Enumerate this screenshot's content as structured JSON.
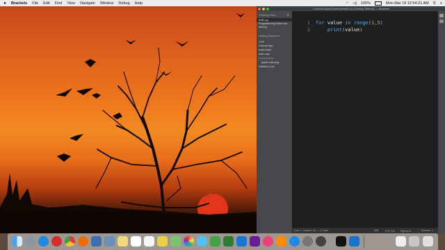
{
  "menubar": {
    "app_name": "Brackets",
    "items": [
      "File",
      "Edit",
      "Find",
      "View",
      "Navigate",
      "Window",
      "Debug",
      "Help"
    ],
    "battery": "100%",
    "clock": "Mon Mar 19  12:54:21 AM"
  },
  "window": {
    "title": "• /Users/Casper/Desktop/hello.py (Getting Started) — Brackets"
  },
  "sidebar": {
    "working_files_header": "Working Files",
    "working_files": [
      "hello.py",
      "Programming Notes.txt",
      "test.py"
    ],
    "project_header": "Getting Started",
    "tree": [
      {
        "label": "1.txt",
        "indent": false
      },
      {
        "label": "Course.cpp",
        "indent": false
      },
      {
        "label": "index.html",
        "indent": false
      },
      {
        "label": "main.css",
        "indent": false
      },
      {
        "label": "screenshots",
        "indent": false
      },
      {
        "label": "quick-edit.png",
        "indent": true
      },
      {
        "label": "Untitled-1.txt",
        "indent": false
      }
    ]
  },
  "editor": {
    "line_numbers": [
      "1",
      "2"
    ],
    "line1": {
      "kw1": "for",
      "var": " value ",
      "kw2": "in",
      "fn": " range",
      "open": "(",
      "n1": "1",
      "comma": ",",
      "n2": "5",
      "close": ")"
    },
    "line2": {
      "indent": "    ",
      "fn": "print",
      "open": "(",
      "arg": "value",
      "close": ")"
    }
  },
  "statusbar": {
    "position": "Line 2, Column 16 — 2 Lines",
    "ins": "INS",
    "encoding": "UTF-8 ▾",
    "language": "Python ▾",
    "spaces": "Spaces: 4"
  }
}
